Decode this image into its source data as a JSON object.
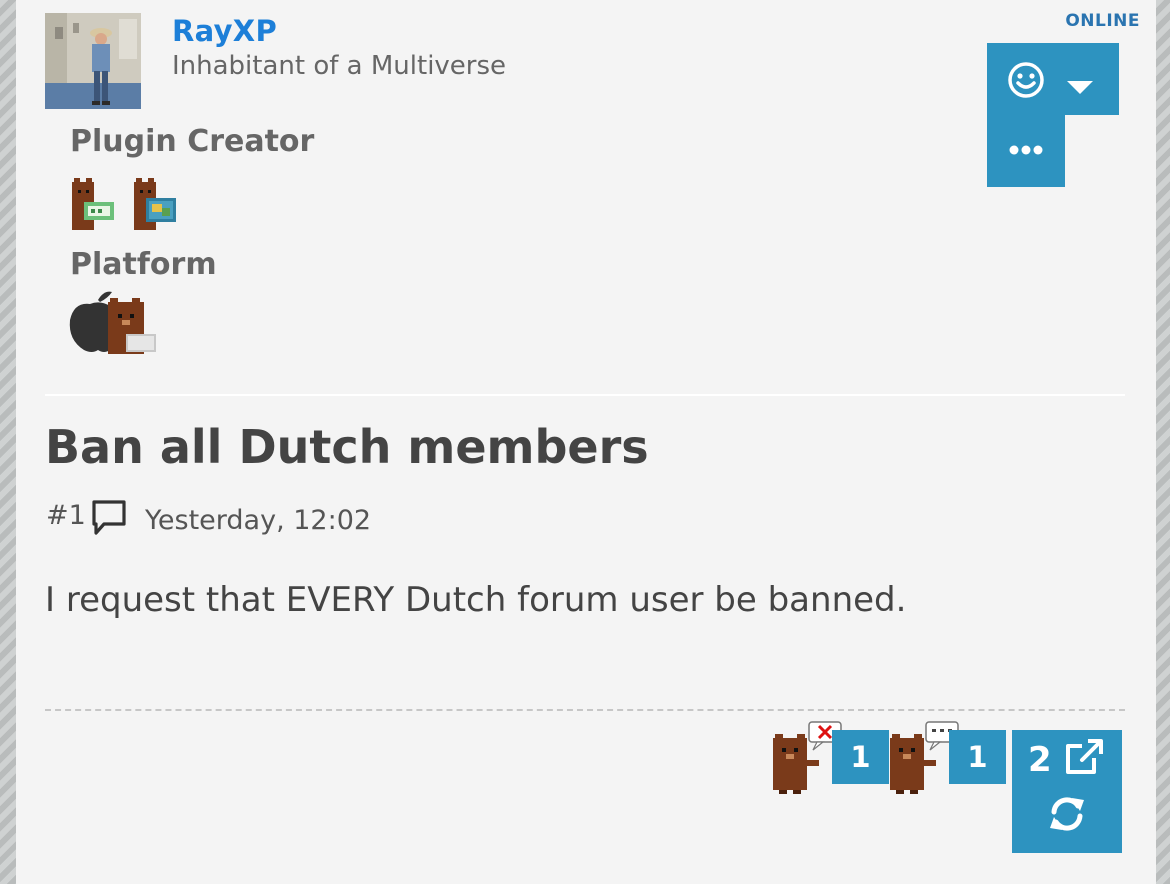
{
  "user": {
    "name": "RayXP",
    "title": "Inhabitant of a Multiverse",
    "status": "ONLINE"
  },
  "groups": [
    {
      "label": "Plugin Creator",
      "badges": [
        "bear-plugin-badge",
        "bear-theme-badge"
      ]
    },
    {
      "label": "Platform",
      "badges": [
        "bear-apple-badge"
      ]
    }
  ],
  "thread": {
    "title": "Ban all Dutch members"
  },
  "post": {
    "number": "#1",
    "date": "Yesterday, 12:02",
    "body": "I request that EVERY Dutch forum user be banned."
  },
  "reactions": [
    {
      "icon": "bear-disagree-icon",
      "count": "1"
    },
    {
      "icon": "bear-comment-icon",
      "count": "1"
    }
  ],
  "share": {
    "count": "2"
  },
  "colors": {
    "accent": "#2d93c0",
    "username": "#1d7fd8",
    "online": "#2a74b0",
    "panel": "#f4f4f4"
  }
}
